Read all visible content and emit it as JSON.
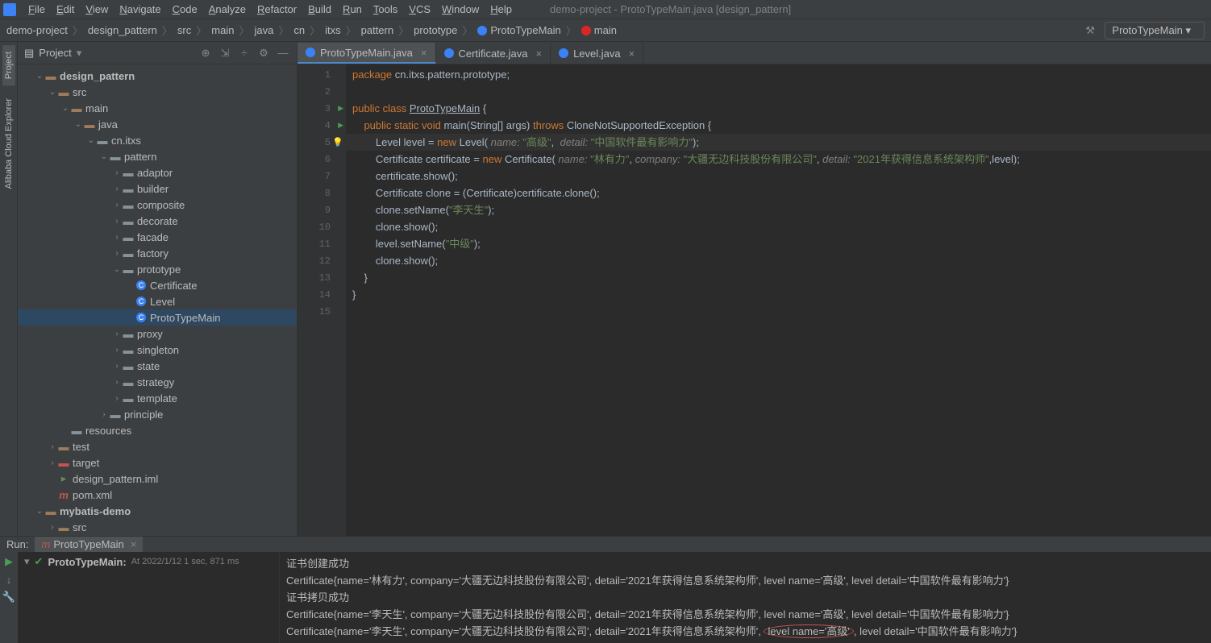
{
  "window_title": "demo-project - ProtoTypeMain.java [design_pattern]",
  "menus": [
    "File",
    "Edit",
    "View",
    "Navigate",
    "Code",
    "Analyze",
    "Refactor",
    "Build",
    "Run",
    "Tools",
    "VCS",
    "Window",
    "Help"
  ],
  "breadcrumbs": [
    "demo-project",
    "design_pattern",
    "src",
    "main",
    "java",
    "cn",
    "itxs",
    "pattern",
    "prototype",
    "ProtoTypeMain",
    "main"
  ],
  "run_config": "ProtoTypeMain",
  "panel": {
    "title": "Project"
  },
  "sidebar_tabs": [
    "Project",
    "Alibaba Cloud Explorer"
  ],
  "tree": {
    "root": "design_pattern",
    "src": "src",
    "main": "main",
    "java": "java",
    "cn": "cn.itxs",
    "pattern": "pattern",
    "folders": [
      "adaptor",
      "builder",
      "composite",
      "decorate",
      "facade",
      "factory"
    ],
    "prototype": "prototype",
    "classes": [
      "Certificate",
      "Level",
      "ProtoTypeMain"
    ],
    "folders2": [
      "proxy",
      "singleton",
      "state",
      "strategy",
      "template"
    ],
    "principle": "principle",
    "resources": "resources",
    "test": "test",
    "target": "target",
    "iml": "design_pattern.iml",
    "pom": "pom.xml",
    "mybatis": "mybatis-demo",
    "src2": "src"
  },
  "tabs": [
    {
      "name": "ProtoTypeMain.java",
      "active": true
    },
    {
      "name": "Certificate.java",
      "active": false
    },
    {
      "name": "Level.java",
      "active": false
    }
  ],
  "code_lines": [
    {
      "n": 1,
      "tokens": [
        {
          "t": "package ",
          "c": "kw"
        },
        {
          "t": "cn.itxs.pattern.prototype;"
        }
      ]
    },
    {
      "n": 2,
      "tokens": []
    },
    {
      "n": 3,
      "marker": "run",
      "tokens": [
        {
          "t": "public class ",
          "c": "kw"
        },
        {
          "t": "ProtoTypeMain",
          "c": "underline"
        },
        {
          "t": " {"
        }
      ]
    },
    {
      "n": 4,
      "marker": "run",
      "tokens": [
        {
          "t": "    "
        },
        {
          "t": "public static void ",
          "c": "kw"
        },
        {
          "t": "main(String[] args) ",
          "c": ""
        },
        {
          "t": "throws ",
          "c": "kw"
        },
        {
          "t": "CloneNotSupportedException {"
        }
      ]
    },
    {
      "n": 5,
      "marker": "bulb",
      "hl": true,
      "tokens": [
        {
          "t": "        Level level = "
        },
        {
          "t": "new ",
          "c": "kw"
        },
        {
          "t": "Level( "
        },
        {
          "t": "name: ",
          "c": "param"
        },
        {
          "t": "\"高级\"",
          "c": "str"
        },
        {
          "t": ",  "
        },
        {
          "t": "detail: ",
          "c": "param"
        },
        {
          "t": "\"中国软件最有影响力\"",
          "c": "str"
        },
        {
          "t": ");"
        }
      ]
    },
    {
      "n": 6,
      "tokens": [
        {
          "t": "        Certificate certificate = "
        },
        {
          "t": "new ",
          "c": "kw"
        },
        {
          "t": "Certificate( "
        },
        {
          "t": "name: ",
          "c": "param"
        },
        {
          "t": "\"林有力\"",
          "c": "str"
        },
        {
          "t": ", "
        },
        {
          "t": "company: ",
          "c": "param"
        },
        {
          "t": "\"大疆无边科技股份有限公司\"",
          "c": "str"
        },
        {
          "t": ", "
        },
        {
          "t": "detail: ",
          "c": "param"
        },
        {
          "t": "\"2021年获得信息系统架构师\"",
          "c": "str"
        },
        {
          "t": ",level);"
        }
      ]
    },
    {
      "n": 7,
      "tokens": [
        {
          "t": "        certificate.show();"
        }
      ]
    },
    {
      "n": 8,
      "tokens": [
        {
          "t": "        Certificate clone = (Certificate)certificate.clone();"
        }
      ]
    },
    {
      "n": 9,
      "tokens": [
        {
          "t": "        clone.setName("
        },
        {
          "t": "\"李天生\"",
          "c": "str"
        },
        {
          "t": ");"
        }
      ]
    },
    {
      "n": 10,
      "tokens": [
        {
          "t": "        clone.show();"
        }
      ]
    },
    {
      "n": 11,
      "tokens": [
        {
          "t": "        level.setName("
        },
        {
          "t": "\"中级\"",
          "c": "str"
        },
        {
          "t": ");"
        }
      ]
    },
    {
      "n": 12,
      "tokens": [
        {
          "t": "        clone.show();"
        }
      ]
    },
    {
      "n": 13,
      "tokens": [
        {
          "t": "    }"
        }
      ]
    },
    {
      "n": 14,
      "tokens": [
        {
          "t": "}"
        }
      ]
    },
    {
      "n": 15,
      "tokens": []
    }
  ],
  "run": {
    "label": "Run:",
    "tab": "ProtoTypeMain",
    "status": "ProtoTypeMain:",
    "status_detail": "At 2022/1/12 1 sec, 871 ms",
    "output": [
      "证书创建成功",
      "Certificate{name='林有力', company='大疆无边科技股份有限公司', detail='2021年获得信息系统架构师', level name='高级', level detail='中国软件最有影响力'}",
      "证书拷贝成功",
      "Certificate{name='李天生', company='大疆无边科技股份有限公司', detail='2021年获得信息系统架构师', level name='高级', level detail='中国软件最有影响力'}",
      "Certificate{name='李天生', company='大疆无边科技股份有限公司', detail='2021年获得信息系统架构师', level name='高级', level detail='中国软件最有影响力'}"
    ],
    "highlight": "level name='高级'"
  }
}
